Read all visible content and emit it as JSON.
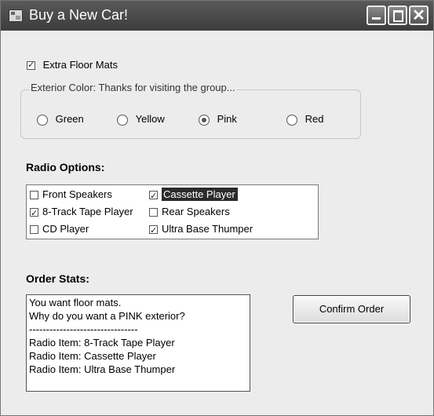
{
  "window": {
    "title": "Buy a New Car!"
  },
  "floor_mats": {
    "label": "Extra Floor Mats",
    "checked": true
  },
  "exterior": {
    "legend": "Exterior Color: Thanks for visiting the group...",
    "options": [
      {
        "label": "Green",
        "selected": false
      },
      {
        "label": "Yellow",
        "selected": false
      },
      {
        "label": "Pink",
        "selected": true
      },
      {
        "label": "Red",
        "selected": false
      }
    ]
  },
  "radio_options": {
    "heading": "Radio Options:",
    "items": [
      {
        "label": "Front Speakers",
        "checked": false,
        "selected": false
      },
      {
        "label": "8-Track Tape Player",
        "checked": true,
        "selected": false
      },
      {
        "label": "CD Player",
        "checked": false,
        "selected": false
      },
      {
        "label": "Cassette Player",
        "checked": true,
        "selected": true
      },
      {
        "label": "Rear Speakers",
        "checked": false,
        "selected": false
      },
      {
        "label": "Ultra Base Thumper",
        "checked": true,
        "selected": false
      }
    ]
  },
  "order_stats": {
    "heading": "Order Stats:",
    "lines": [
      "You want floor mats.",
      "Why do you want a PINK exterior?",
      "--------------------------------",
      "Radio Item: 8-Track Tape Player",
      "Radio Item: Cassette Player",
      "Radio Item: Ultra Base Thumper"
    ]
  },
  "confirm_button": {
    "label": "Confirm Order"
  }
}
